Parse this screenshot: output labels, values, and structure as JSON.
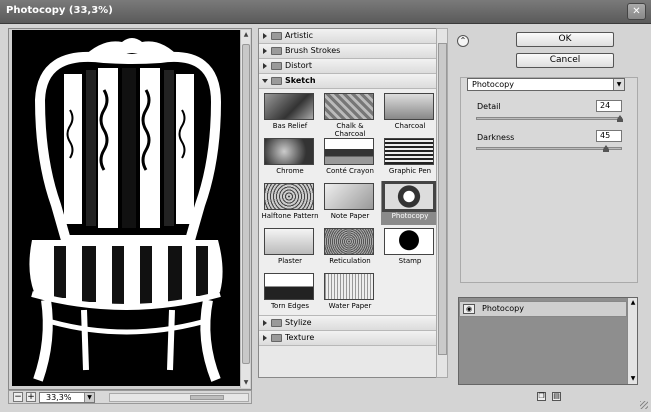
{
  "window": {
    "title": "Photocopy (33,3%)",
    "close_glyph": "✕"
  },
  "preview": {
    "zoom": "33,3%",
    "minus": "−",
    "plus": "+"
  },
  "categories_top": [
    {
      "label": "Artistic",
      "open": false
    },
    {
      "label": "Brush Strokes",
      "open": false
    },
    {
      "label": "Distort",
      "open": false
    },
    {
      "label": "Sketch",
      "open": true
    }
  ],
  "thumbnails": [
    {
      "label": "Bas Relief"
    },
    {
      "label": "Chalk & Charcoal"
    },
    {
      "label": "Charcoal"
    },
    {
      "label": "Chrome"
    },
    {
      "label": "Conté Crayon"
    },
    {
      "label": "Graphic Pen"
    },
    {
      "label": "Halftone Pattern"
    },
    {
      "label": "Note Paper"
    },
    {
      "label": "Photocopy",
      "selected": true
    },
    {
      "label": "Plaster"
    },
    {
      "label": "Reticulation"
    },
    {
      "label": "Stamp"
    },
    {
      "label": "Torn Edges"
    },
    {
      "label": "Water Paper"
    }
  ],
  "categories_bottom": [
    {
      "label": "Stylize",
      "open": false
    },
    {
      "label": "Texture",
      "open": false
    }
  ],
  "buttons": {
    "ok": "OK",
    "cancel": "Cancel"
  },
  "filter_select": {
    "value": "Photocopy"
  },
  "params": {
    "detail": {
      "label": "Detail",
      "value": "24",
      "level": 24,
      "max": 24
    },
    "darkness": {
      "label": "Darkness",
      "value": "45",
      "level": 45,
      "max": 50
    }
  },
  "layers": [
    {
      "label": "Photocopy"
    }
  ]
}
